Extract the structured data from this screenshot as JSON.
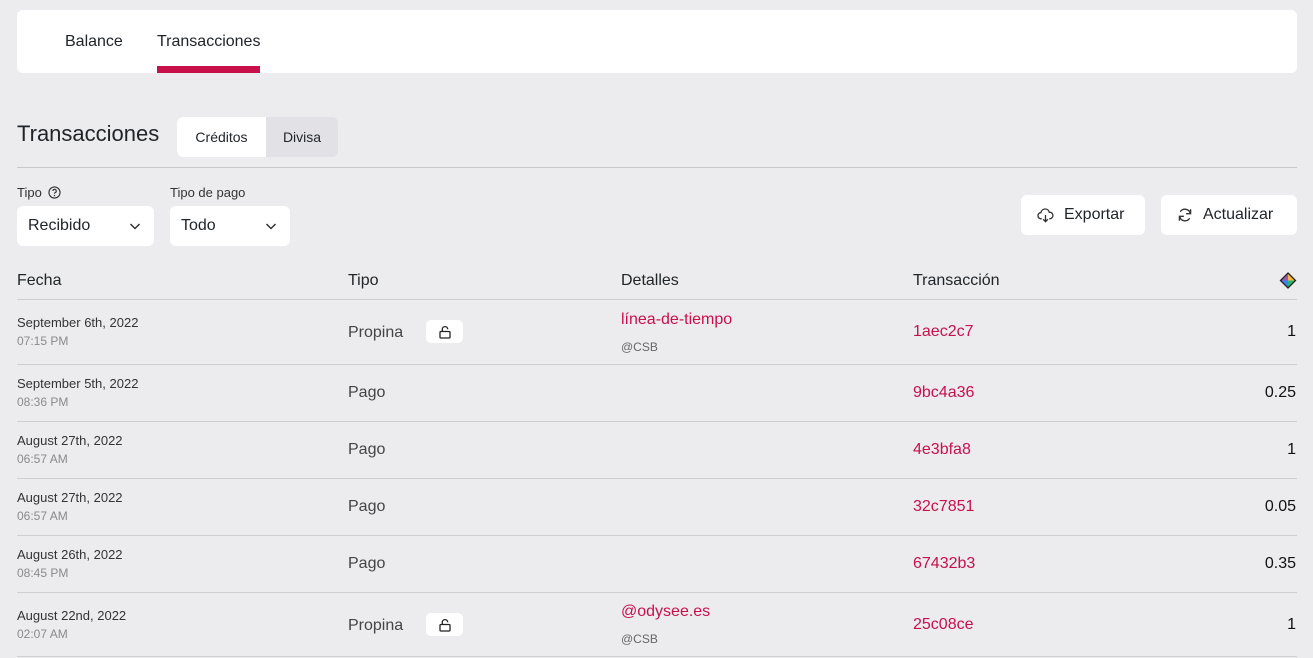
{
  "tabs": {
    "balance": "Balance",
    "transactions": "Transacciones"
  },
  "section": {
    "title": "Transacciones",
    "seg_credits": "Créditos",
    "seg_currency": "Divisa"
  },
  "filters": {
    "type_label": "Tipo",
    "type_value": "Recibido",
    "payment_label": "Tipo de pago",
    "payment_value": "Todo"
  },
  "actions": {
    "export": "Exportar",
    "refresh": "Actualizar"
  },
  "table": {
    "headers": {
      "date": "Fecha",
      "type": "Tipo",
      "details": "Detalles",
      "transaction": "Transacción"
    },
    "rows": [
      {
        "date": "September 6th, 2022",
        "time": "07:15 PM",
        "type": "Propina",
        "locked": true,
        "details": "línea-de-tiempo",
        "details_sub": "@CSB",
        "tx": "1aec2c7",
        "amount": "1"
      },
      {
        "date": "September 5th, 2022",
        "time": "08:36 PM",
        "type": "Pago",
        "locked": false,
        "details": "",
        "details_sub": "",
        "tx": "9bc4a36",
        "amount": "0.25"
      },
      {
        "date": "August 27th, 2022",
        "time": "06:57 AM",
        "type": "Pago",
        "locked": false,
        "details": "",
        "details_sub": "",
        "tx": "4e3bfa8",
        "amount": "1"
      },
      {
        "date": "August 27th, 2022",
        "time": "06:57 AM",
        "type": "Pago",
        "locked": false,
        "details": "",
        "details_sub": "",
        "tx": "32c7851",
        "amount": "0.05"
      },
      {
        "date": "August 26th, 2022",
        "time": "08:45 PM",
        "type": "Pago",
        "locked": false,
        "details": "",
        "details_sub": "",
        "tx": "67432b3",
        "amount": "0.35"
      },
      {
        "date": "August 22nd, 2022",
        "time": "02:07 AM",
        "type": "Propina",
        "locked": true,
        "details": "@odysee.es",
        "details_sub": "@CSB",
        "tx": "25c08ce",
        "amount": "1"
      }
    ]
  },
  "colors": {
    "accent": "#c8104a",
    "background": "#ececee"
  }
}
